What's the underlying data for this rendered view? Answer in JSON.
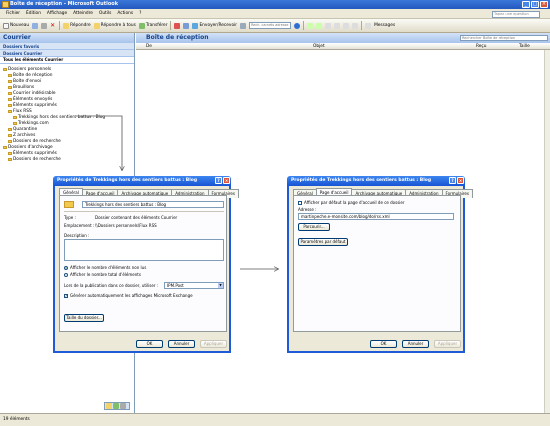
{
  "window": {
    "title": "Boîte de réception - Microsoft Outlook"
  },
  "menu": [
    "Fichier",
    "Édition",
    "Affichage",
    "Atteindre",
    "Outils",
    "Actions",
    "?"
  ],
  "ask_placeholder": "Tapez une question",
  "toolbar": {
    "new": "Nouveau",
    "reply": "Répondre",
    "reply_all": "Répondre à tous",
    "forward": "Transférer",
    "send_receive": "Envoyer/Recevoir",
    "search_placeholder": "Rech. carnets adresse",
    "messages": "Messages"
  },
  "nav": {
    "header": "Courrier",
    "favorites": "Dossiers favoris",
    "mail_folders": "Dossiers Courrier",
    "all_items": "Tous les éléments Courrier",
    "folders": [
      {
        "label": "Dossiers personnels",
        "level": 0
      },
      {
        "label": "Boîte de réception",
        "level": 1
      },
      {
        "label": "Boîte d'envoi",
        "level": 1
      },
      {
        "label": "Brouillons",
        "level": 1
      },
      {
        "label": "Courrier indésirable",
        "level": 1
      },
      {
        "label": "Éléments envoyés",
        "level": 1
      },
      {
        "label": "Éléments supprimés",
        "level": 1
      },
      {
        "label": "Flux RSS",
        "level": 1
      },
      {
        "label": "Trekkings hors des sentiers battus : Blog",
        "level": 2
      },
      {
        "label": "Trekkings.com",
        "level": 2
      },
      {
        "label": "Quarantine",
        "level": 1
      },
      {
        "label": "Z archives",
        "level": 1
      },
      {
        "label": "Dossiers de recherche",
        "level": 1
      },
      {
        "label": "Dossiers d'archivage",
        "level": 0
      },
      {
        "label": "Éléments supprimés",
        "level": 1
      },
      {
        "label": "Dossiers de recherche",
        "level": 1
      }
    ]
  },
  "main": {
    "title": "Boîte de réception",
    "search_placeholder": "Rechercher Boîte de réception",
    "col_from": "De",
    "col_subject": "Objet",
    "col_received": "Reçu",
    "col_size": "Taille"
  },
  "status": {
    "text": "19 éléments"
  },
  "dialog1": {
    "title": "Propriétés de Trekkings hors des sentiers battus : Blog",
    "tabs": [
      "Général",
      "Page d'accueil",
      "Archivage automatique",
      "Administration",
      "Formulaires"
    ],
    "name": "Trekkings hors des sentiers battus : Blog",
    "type_label": "Type :",
    "type_value": "Dossier contenant des éléments Courrier",
    "location_label": "Emplacement :",
    "location_value": "\\\\Dossiers personnels\\Flux RSS",
    "desc_label": "Description :",
    "radio_unread": "Afficher le nombre d'éléments non lus",
    "radio_total": "Afficher le nombre total d'éléments",
    "post_label": "Lors de la publication dans ce dossier, utiliser :",
    "post_value": "IPM.Post",
    "exchange_label": "Générer automatiquement les affichages Microsoft Exchange",
    "size_button": "Taille du dossier...",
    "ok": "OK",
    "cancel": "Annuler",
    "apply": "Appliquer"
  },
  "dialog2": {
    "title": "Propriétés de Trekkings hors des sentiers battus : Blog",
    "tabs": [
      "Général",
      "Page d'accueil",
      "Archivage automatique",
      "Administration",
      "Formulaires"
    ],
    "home_checkbox": "Afficher par défaut la page d'accueil de ce dossier",
    "address_label": "Adresse :",
    "address_value": "martinpeche.e-monsite.com/blog/do/rss.xml",
    "browse": "Parcourir...",
    "defaults": "Paramètres par défaut",
    "ok": "OK",
    "cancel": "Annuler",
    "apply": "Appliquer"
  },
  "colors": {
    "accent": "#1f5bd6",
    "toolbar": "#ece9d8",
    "nav_header": "#a7c3ec",
    "arrow": "#555555"
  }
}
